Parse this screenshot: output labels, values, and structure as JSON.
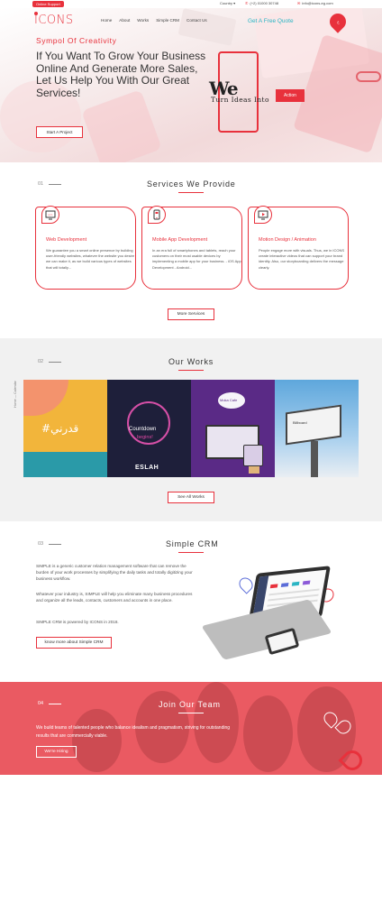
{
  "topbar": {
    "online_support": "Online Support",
    "country": "Country ▾",
    "phone": "(+2) 01000 30748",
    "email": "info@icons-eg.com"
  },
  "header": {
    "logo": "ICONS",
    "nav": [
      "Home",
      "About",
      "Works",
      "Simple CRM",
      "Contact Us"
    ],
    "free_quote": "Get A Free Quote",
    "lang": "ع"
  },
  "hero": {
    "tagline": "Sympol Of Creativity",
    "title": "If You Want To Grow Your Business Online And Generate More Sales, Let Us Help You With Our Great Services!",
    "start_button": "Start A Project",
    "we": "We",
    "turn_ideas": "Turn Ideas Into",
    "action": "Action"
  },
  "services": {
    "num": "01",
    "title": "Services We Provide",
    "items": [
      {
        "icon": "web-development-icon",
        "title": "Web Development",
        "desc": "We guarantee you a smart online presence by building user-friendly websites, whatever the website you desire we can make it, as we build various types of websites that will totally..."
      },
      {
        "icon": "mobile-app-icon",
        "title": "Mobile App Development",
        "desc": "In an era full of smartphones and tablets, reach your customers on their most usable devices by implementing a mobile app for your business. - iOS App Development - Android..."
      },
      {
        "icon": "motion-design-icon",
        "title": "Motion Design / Animation",
        "desc": "People engage more with visuals. Thus, we in ICONS create interactive videos that can support your brand identity. Also, our storyboarding delivers the message clearly."
      }
    ],
    "more_button": "More Services"
  },
  "works": {
    "num": "02",
    "title": "Our Works",
    "side": "Home — Calendar",
    "items": [
      {
        "label": "#قدرني",
        "color": "#f2b53b"
      },
      {
        "label": "Countdown",
        "sub": "begins!",
        "brand": "ESLAH",
        "color": "#1e1f3a"
      },
      {
        "label": "Moka Cafe",
        "color": "#5a2a86"
      },
      {
        "label": "Billboard",
        "color": "#3a8ec9"
      }
    ],
    "all_button": "See All Works"
  },
  "crm": {
    "num": "03",
    "title": "Simple CRM",
    "paragraphs": [
      "SIMPLE is a generic customer relation management software that can remove the burden of your work processes by simplifying the daily tasks and totally digitizing your business workflow.",
      "Whatever your industry is, SIMPLE will help you eliminate many business procedures and organize all the leads, contacts, customers and accounts in one place.",
      "SIMPLE CRM is powered by ICONS in 2018."
    ],
    "button": "know more about Simple CRM"
  },
  "team": {
    "num": "04",
    "title": "Join Our Team",
    "text": "We build teams of talented people who balance idealism and pragmatism, striving for outstanding results that are commercially viable.",
    "button": "We're Hiring"
  },
  "colors": {
    "accent": "#e8313c",
    "teal": "#2bb5c4",
    "team_bg": "#ea5a62",
    "works_bg": "#f1f1f1"
  }
}
